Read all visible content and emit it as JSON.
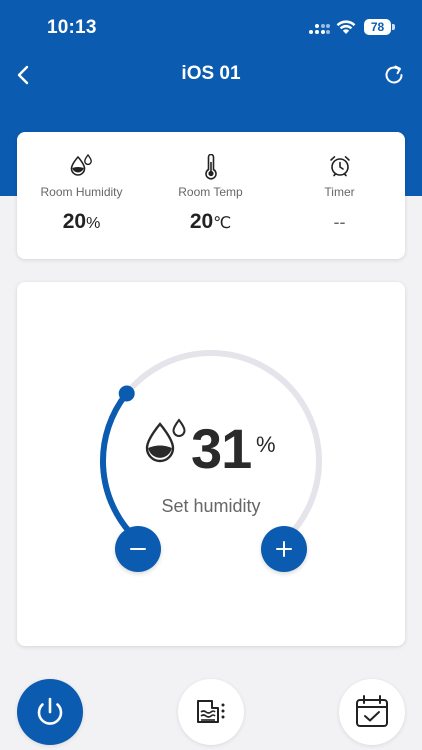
{
  "status_bar": {
    "time": "10:13",
    "battery": "78"
  },
  "nav": {
    "title": "iOS 01"
  },
  "info": {
    "humidity": {
      "label": "Room Humidity",
      "value": "20",
      "unit": "%"
    },
    "temp": {
      "label": "Room Temp",
      "value": "20",
      "unit": "℃"
    },
    "timer": {
      "label": "Timer",
      "value": "--"
    }
  },
  "dial": {
    "set_value": "31",
    "unit": "%",
    "label": "Set humidity",
    "level_percent": 31
  },
  "colors": {
    "primary": "#0b5bb0",
    "track": "#e4e4ea",
    "background": "#f2f2f4"
  },
  "icons": {
    "back": "chevron-left-icon",
    "refresh": "refresh-icon",
    "humidity": "water-drops-icon",
    "temp": "thermometer-icon",
    "timer": "alarm-clock-icon",
    "minus": "minus-icon",
    "plus": "plus-icon",
    "power": "power-icon",
    "water_tank": "water-tank-icon",
    "schedule": "calendar-check-icon"
  }
}
